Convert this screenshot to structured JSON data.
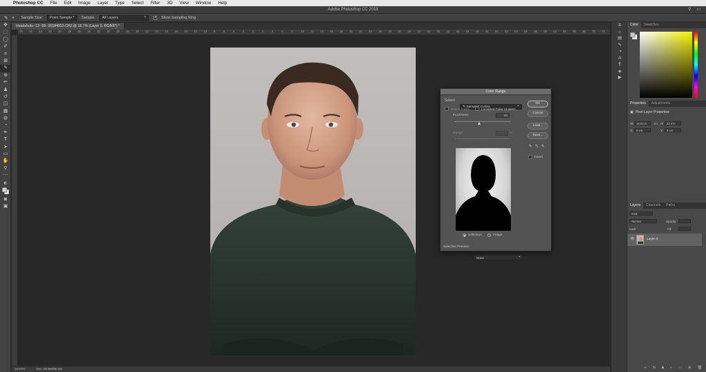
{
  "macbar": {
    "apple": "",
    "app": "Photoshop CC",
    "menus": [
      "File",
      "Edit",
      "Image",
      "Layer",
      "Type",
      "Select",
      "Filter",
      "3D",
      "View",
      "Window",
      "Help"
    ]
  },
  "window": {
    "title": "Adobe Photoshop CC 2018"
  },
  "options": {
    "sample_size_label": "Sample Size:",
    "sample_size_value": "Point Sample",
    "sample_label": "Sample:",
    "sample_value": "All Layers",
    "ring_label": "Show Sampling Ring"
  },
  "document": {
    "tab": "Headshots--13--99--20184812.CR2 @ 16.7% (Layer 0, RGB/8*) *",
    "ruler_labels": [
      "48",
      "46",
      "44",
      "42",
      "40",
      "38",
      "36",
      "34",
      "32",
      "30",
      "28",
      "26",
      "24",
      "22",
      "20",
      "18",
      "16",
      "14",
      "12",
      "10",
      "8",
      "6",
      "4",
      "2",
      "0",
      "2",
      "4",
      "6",
      "8",
      "10",
      "12",
      "14",
      "16",
      "18",
      "20",
      "22",
      "24",
      "26",
      "28",
      "30",
      "32",
      "34",
      "36",
      "38",
      "40",
      "42",
      "44",
      "46",
      "48",
      "50",
      "52",
      "54",
      "56",
      "58",
      "60",
      "62",
      "64",
      "66",
      "68",
      "70",
      "72"
    ],
    "zoom": "16.67%",
    "doc_size": "Doc: 69.9M/89.4M"
  },
  "color_range": {
    "title": "Color Range",
    "select_label": "Select:",
    "select_value": "Sampled Colors",
    "detect_faces": "Detect Faces",
    "localized": "Localized Color Clusters",
    "fuzziness_label": "Fuzziness:",
    "fuzziness_value": "44",
    "range_label": "Range:",
    "range_unit": "%",
    "ok": "OK",
    "cancel": "Cancel",
    "load": "Load...",
    "save": "Save...",
    "invert": "Invert",
    "opt_selection": "Selection",
    "opt_image": "Image",
    "preview_label": "Selection Preview:",
    "preview_value": "None",
    "fuzziness_fraction": 0.44
  },
  "panels": {
    "color_tabs": [
      "Color",
      "Swatches"
    ],
    "properties_tabs": [
      "Properties",
      "Adjustments"
    ],
    "properties_title": "Pixel Layer Properties",
    "w_label": "W:",
    "w_value": "14.61 in",
    "go_label": "GO",
    "h_label": "H:",
    "h_value": "22.4 in",
    "x_label": "X:",
    "x_value": "0 cm",
    "y_label": "Y:",
    "y_value": "0 cm",
    "layers_tabs": [
      "Layers",
      "Channels",
      "Paths"
    ],
    "kind": "Kind",
    "blend": "Normal",
    "opacity_label": "Opacity:",
    "lock_label": "Lock:",
    "fill_label": "Fill:",
    "layer_name": "Layer 0"
  },
  "colors": {
    "accent_dialog": "#535353",
    "sweater": "#2c3a2c",
    "background": "#282828"
  }
}
